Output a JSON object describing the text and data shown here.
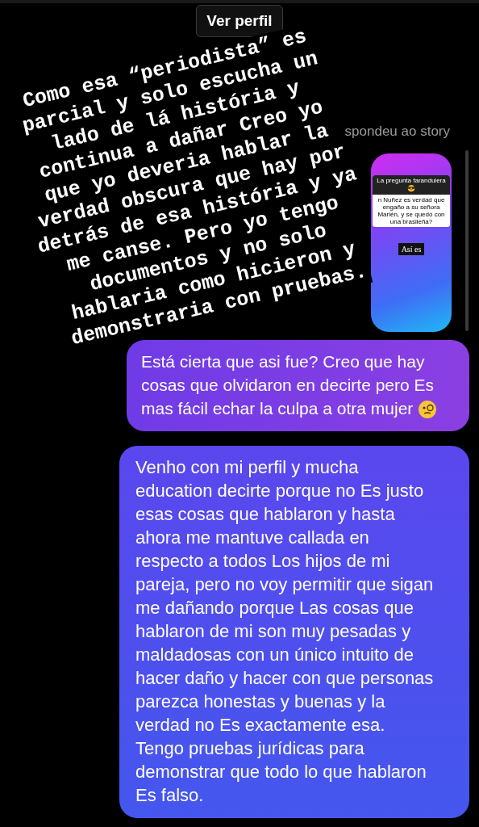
{
  "header": {
    "profile_button": "Ver perfil"
  },
  "story_reply": {
    "label": "spondeu ao story",
    "question_title": "La pregunta farandulera 😎",
    "question": "n Nuñez es verdad que engaño a su señora Marlén, y se quedó con una brasileña?",
    "answer": "Así es"
  },
  "messages": [
    {
      "text": "Está cierta que asi fue? Creo que hay cosas que olvidaron en decirte pero Es mas fácil echar la culpa a otra mujer",
      "emoji": true
    },
    {
      "text": "Venho con mi perfil y mucha education decirte porque no Es justo esas cosas que hablaron y hasta ahora me mantuve callada en respecto a todos Los hijos de mi pareja, pero no voy permitir que sigan me dañando porque Las cosas que hablaron de mi son muy pesadas y maldadosas con un único intuito de hacer daño y hacer con que personas parezca honestas y buenas y la verdad no Es exactamente esa. Tengo pruebas jurídicas para demonstrar que todo lo que hablaron Es falso.",
      "emoji": false
    }
  ],
  "overlay_lines": [
    "Como esa “periodista” es",
    "parcial y solo escucha un",
    "lado de lá história y",
    "continua a dañar Creo yo",
    "que yo deveria hablar la",
    "verdad obscura que hay por",
    "detrás de esa história y ya",
    "me canse. Pero yo tengo",
    "documentos y no solo",
    "hablaria como hicieron y",
    "demonstraria con pruebas."
  ]
}
